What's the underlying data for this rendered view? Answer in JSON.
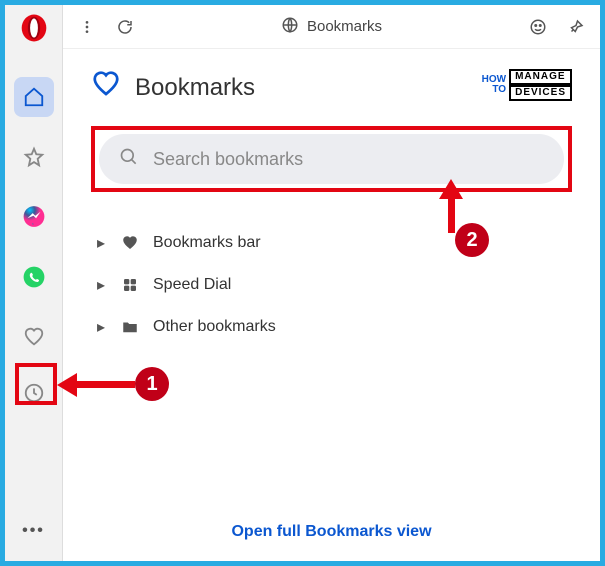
{
  "topbar": {
    "title": "Bookmarks"
  },
  "page": {
    "heading": "Bookmarks",
    "search_placeholder": "Search bookmarks",
    "folders": [
      {
        "icon": "heart",
        "label": "Bookmarks bar"
      },
      {
        "icon": "grid",
        "label": "Speed Dial"
      },
      {
        "icon": "folder",
        "label": "Other bookmarks"
      }
    ],
    "open_full_link": "Open full Bookmarks view"
  },
  "watermark": {
    "left_top": "HOW",
    "left_bottom": "TO",
    "right_top": "MANAGE",
    "right_bottom": "DEVICES"
  },
  "annotations": {
    "marker1": "1",
    "marker2": "2"
  }
}
